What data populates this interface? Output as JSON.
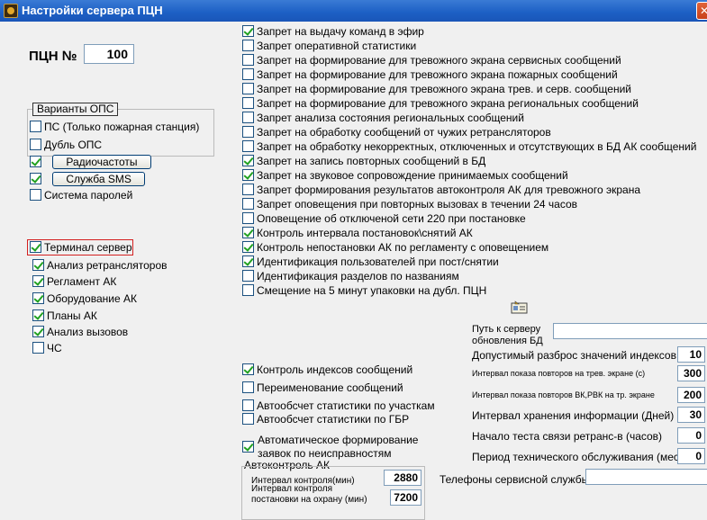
{
  "window": {
    "title": "Настройки сервера ПЦН",
    "close_glyph": "✕",
    "icon": "fire-station-icon"
  },
  "pcn": {
    "label": "ПЦН №",
    "value": "100"
  },
  "ops_group": {
    "legend": "Варианты ОПС",
    "items": [
      {
        "label": "ПС (Только пожарная станция)",
        "checked": false
      },
      {
        "label": "Дубль ОПС",
        "checked": false
      }
    ]
  },
  "left_controls": {
    "radio_freq": {
      "label": "Радиочастоты",
      "checked": true
    },
    "sms_service": {
      "label": "Служба SMS",
      "checked": true
    },
    "password_system": {
      "label": "Система паролей",
      "checked": false
    }
  },
  "terminal_server": {
    "label": "Терминал сервер",
    "checked": true,
    "items": [
      {
        "label": "Анализ ретрансляторов",
        "checked": true
      },
      {
        "label": "Регламент АК",
        "checked": true
      },
      {
        "label": "Оборудование АК",
        "checked": true
      },
      {
        "label": "Планы АК",
        "checked": true
      },
      {
        "label": "Анализ вызовов",
        "checked": true
      },
      {
        "label": "ЧС",
        "checked": false
      }
    ]
  },
  "right_options": [
    {
      "label": "Запрет на выдачу команд в эфир",
      "checked": true
    },
    {
      "label": "Запрет оперативной статистики",
      "checked": false
    },
    {
      "label": "Запрет на формирование для тревожного экрана сервисных сообщений",
      "checked": false
    },
    {
      "label": "Запрет на формирование для тревожного экрана пожарных сообщений",
      "checked": false
    },
    {
      "label": "Запрет на формирование для тревожного экрана трев. и серв. сообщений",
      "checked": false
    },
    {
      "label": "Запрет на формирование для тревожного экрана региональных сообщений",
      "checked": false
    },
    {
      "label": "Запрет анализа состояния региональных сообщений",
      "checked": false
    },
    {
      "label": "Запрет на  обработку  сообщений от чужих ретрансляторов",
      "checked": false
    },
    {
      "label": "Запрет на обработку некорректных, отключенных и отсутствующих в БД  АК сообщений",
      "checked": false
    },
    {
      "label": "Запрет на запись повторных сообщений в БД",
      "checked": true
    },
    {
      "label": "Запрет на звуковое сопровождение принимаемых сообщений",
      "checked": true
    },
    {
      "label": "Запрет формирования результатов автоконтроля АК для тревожного экрана",
      "checked": false
    },
    {
      "label": "Запрет оповещения при повторных вызовах в течении 24 часов",
      "checked": false
    },
    {
      "label": "Оповещение об отключеной сети 220 при постановке",
      "checked": false
    },
    {
      "label": "Контроль интервала  постановок\\снятий АК",
      "checked": true
    },
    {
      "label": "Контроль непостановки АК по регламенту с оповещением",
      "checked": true
    },
    {
      "label": "Идентификация пользователей при пост/снятии",
      "checked": true
    },
    {
      "label": "Идентификация разделов по названиям",
      "checked": false
    },
    {
      "label": "Смещение  на 5 минут упаковки на дубл. ПЦН",
      "checked": false
    }
  ],
  "lower_left_options": [
    {
      "label": "Контроль индексов сообщений",
      "checked": true
    },
    {
      "label": "Переименование сообщений",
      "checked": false
    },
    {
      "label": "Автообсчет статистики по участкам",
      "checked": false
    },
    {
      "label": "Автообсчет статистики по ГБР",
      "checked": false
    }
  ],
  "auto_form": {
    "line1": "Автоматическое формирование",
    "line2": "заявок по неисправностям",
    "checked": true
  },
  "autocontrol": {
    "legend": "Автоконтроль АК",
    "interval_label": "Интервал контроля(мин)",
    "interval_value": "2880",
    "guard_label_1": "Интервал контроля",
    "guard_label_2": "постановки на охрану (мин)",
    "guard_value": "7200"
  },
  "update_path": {
    "label_1": "Путь к серверу",
    "label_2": "обновления БД",
    "value": ""
  },
  "params": [
    {
      "label": "Допустимый разброс значений индексов",
      "value": "10",
      "small": false
    },
    {
      "label": "Интервал показа повторов на  трев. экране (с)",
      "value": "300",
      "small": true
    },
    {
      "label": "Интервал показа повторов ВК,РВК на  тр. экране",
      "value": "200",
      "small": true
    },
    {
      "label": "Интервал хранения информации (Дней)",
      "value": "30",
      "small": false
    },
    {
      "label": "Начало теста связи ретранс-в (часов)",
      "value": "0",
      "small": false
    },
    {
      "label": "Период технического обслуживания (мес)",
      "value": "0",
      "small": false
    }
  ],
  "service_phones": {
    "label": "Телефоны сервисной службы",
    "value": ""
  }
}
